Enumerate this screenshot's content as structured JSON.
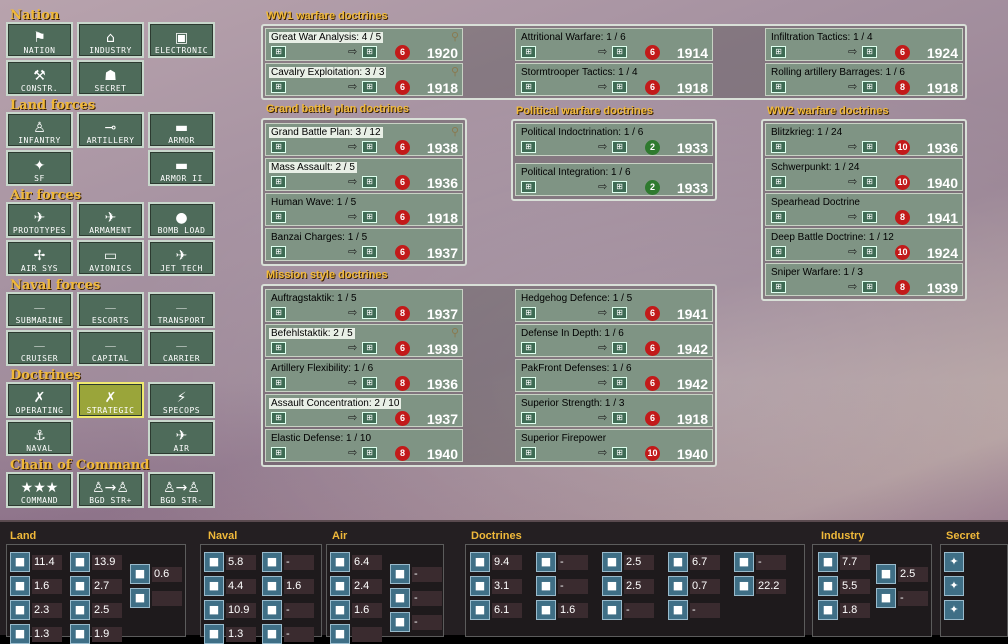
{
  "categories": [
    {
      "title": "Nation",
      "buttons": [
        {
          "label": "NATION",
          "icon": "flag-icon",
          "glyph": "⚑"
        },
        {
          "label": "INDUSTRY",
          "icon": "factory-icon",
          "glyph": "⌂"
        },
        {
          "label": "ELECTRONIC",
          "icon": "chip-icon",
          "glyph": "▣"
        },
        {
          "label": "CONSTR.",
          "icon": "construction-icon",
          "glyph": "⚒"
        },
        {
          "label": "SECRET",
          "icon": "agent-icon",
          "glyph": "☗"
        }
      ]
    },
    {
      "title": "Land forces",
      "buttons": [
        {
          "label": "INFANTRY",
          "icon": "infantry-icon",
          "glyph": "♙"
        },
        {
          "label": "ARTILLERY",
          "icon": "artillery-icon",
          "glyph": "⊸"
        },
        {
          "label": "ARMOR",
          "icon": "tank-icon",
          "glyph": "▬"
        },
        {
          "label": "SF",
          "icon": "special-forces-icon",
          "glyph": "✦"
        },
        {
          "label": "ARMOR II",
          "icon": "tank-icon",
          "glyph": "▬"
        }
      ]
    },
    {
      "title": "Air forces",
      "buttons": [
        {
          "label": "PROTOTYPES",
          "icon": "plane-icon",
          "glyph": "✈"
        },
        {
          "label": "ARMAMENT",
          "icon": "plane-icon",
          "glyph": "✈"
        },
        {
          "label": "BOMB LOAD",
          "icon": "bomb-icon",
          "glyph": "●"
        },
        {
          "label": "AIR SYS",
          "icon": "propeller-icon",
          "glyph": "✢"
        },
        {
          "label": "AVIONICS",
          "icon": "radio-icon",
          "glyph": "▭"
        },
        {
          "label": "JET TECH",
          "icon": "jet-icon",
          "glyph": "✈"
        }
      ]
    },
    {
      "title": "Naval forces",
      "buttons": [
        {
          "label": "SUBMARINE",
          "icon": "submarine-icon",
          "glyph": "⏤"
        },
        {
          "label": "ESCORTS",
          "icon": "ship-icon",
          "glyph": "⏤"
        },
        {
          "label": "TRANSPORT",
          "icon": "ship-icon",
          "glyph": "⏤"
        },
        {
          "label": "CRUISER",
          "icon": "ship-icon",
          "glyph": "⏤"
        },
        {
          "label": "CAPITAL",
          "icon": "ship-icon",
          "glyph": "⏤"
        },
        {
          "label": "CARRIER",
          "icon": "carrier-icon",
          "glyph": "⏤"
        }
      ]
    },
    {
      "title": "Doctrines",
      "buttons": [
        {
          "label": "OPERATING",
          "icon": "doctrine-icon",
          "glyph": "✗"
        },
        {
          "label": "STRATEGIC",
          "icon": "doctrine-icon",
          "glyph": "✗"
        },
        {
          "label": "SPECOPS",
          "icon": "lightning-icon",
          "glyph": "⚡"
        },
        {
          "label": "NAVAL",
          "icon": "anchor-icon",
          "glyph": "⚓"
        },
        {
          "label": "AIR",
          "icon": "plane-icon",
          "glyph": "✈"
        }
      ]
    },
    {
      "title": "Chain of Command",
      "buttons": [
        {
          "label": "COMMAND",
          "icon": "stars-icon",
          "glyph": "★★★"
        },
        {
          "label": "BGD STR+",
          "icon": "brigade-plus-icon",
          "glyph": "♙→♙"
        },
        {
          "label": "BGD STR-",
          "icon": "brigade-minus-icon",
          "glyph": "♙→♙"
        }
      ]
    }
  ],
  "groups": {
    "ww1": "WW1 warfare doctrines",
    "grand": "Grand battle plan doctrines",
    "political": "Political warfare doctrines",
    "ww2": "WW2 warfare doctrines",
    "mission": "Mission style doctrines"
  },
  "cards": [
    {
      "name": "Great War Analysis: 4 / 5",
      "cost": "6",
      "year": "1920",
      "lit": true,
      "mag": true
    },
    {
      "name": "Cavalry Exploitation: 3 / 3",
      "cost": "6",
      "year": "1918",
      "lit": true,
      "mag": true
    },
    {
      "name": "Attritional Warfare: 1 / 6",
      "cost": "6",
      "year": "1914"
    },
    {
      "name": "Stormtrooper Tactics: 1 / 4",
      "cost": "6",
      "year": "1918"
    },
    {
      "name": "Infiltration Tactics: 1 / 4",
      "cost": "6",
      "year": "1924"
    },
    {
      "name": "Rolling artillery Barrages: 1 / 6",
      "cost": "8",
      "year": "1918"
    },
    {
      "name": "Grand Battle Plan: 3 / 12",
      "cost": "6",
      "year": "1938",
      "lit": true,
      "mag": true
    },
    {
      "name": "Mass Assault: 2 / 5",
      "cost": "6",
      "year": "1936",
      "lit": true
    },
    {
      "name": "Human Wave: 1 / 5",
      "cost": "6",
      "year": "1918"
    },
    {
      "name": "Banzai Charges: 1 / 5",
      "cost": "6",
      "year": "1937"
    },
    {
      "name": "Political Indoctrination: 1 / 6",
      "cost": "2",
      "year": "1933",
      "green": true
    },
    {
      "name": "Political Integration: 1 / 6",
      "cost": "2",
      "year": "1933",
      "green": true
    },
    {
      "name": "Blitzkrieg: 1 / 24",
      "cost": "10",
      "year": "1936"
    },
    {
      "name": "Schwerpunkt: 1 / 24",
      "cost": "10",
      "year": "1940"
    },
    {
      "name": "Spearhead Doctrine",
      "cost": "8",
      "year": "1941"
    },
    {
      "name": "Deep Battle Doctrine: 1 / 12",
      "cost": "10",
      "year": "1924"
    },
    {
      "name": "Sniper Warfare: 1 / 3",
      "cost": "8",
      "year": "1939"
    },
    {
      "name": "Auftragstaktik: 1 / 5",
      "cost": "8",
      "year": "1937"
    },
    {
      "name": "Befehlstaktik: 2 / 5",
      "cost": "6",
      "year": "1939",
      "lit": true,
      "mag": true
    },
    {
      "name": "Artillery Flexibility: 1 / 6",
      "cost": "8",
      "year": "1936"
    },
    {
      "name": "Assault Concentration: 2 / 10",
      "cost": "6",
      "year": "1937",
      "lit": true
    },
    {
      "name": "Elastic Defense: 1 / 10",
      "cost": "8",
      "year": "1940"
    },
    {
      "name": "Hedgehog Defence: 1 / 5",
      "cost": "6",
      "year": "1941"
    },
    {
      "name": "Defense In Depth: 1 / 6",
      "cost": "6",
      "year": "1942"
    },
    {
      "name": "PakFront Defenses: 1 / 6",
      "cost": "6",
      "year": "1942"
    },
    {
      "name": "Superior Strength: 1 / 3",
      "cost": "6",
      "year": "1918"
    },
    {
      "name": "Superior Firepower",
      "cost": "10",
      "year": "1940"
    }
  ],
  "bottom": {
    "land": {
      "title": "Land",
      "values": [
        "11.4",
        "13.9",
        "1.6",
        "2.7",
        "2.3",
        "2.5",
        "1.3",
        "1.9"
      ],
      "side": [
        "0.6",
        ""
      ]
    },
    "naval": {
      "title": "Naval",
      "values": [
        "5.8",
        "-",
        "4.4",
        "1.6",
        "10.9",
        "-",
        "1.3",
        "-"
      ]
    },
    "air": {
      "title": "Air",
      "values": [
        "6.4",
        "2.4",
        "1.6",
        ""
      ],
      "side": [
        "-",
        "-",
        "-"
      ]
    },
    "doctrines": {
      "title": "Doctrines",
      "values": [
        "9.4",
        "-",
        "2.5",
        "6.7",
        "-",
        "3.1",
        "-",
        "2.5",
        "0.7",
        "22.2",
        "6.1",
        "1.6",
        "-",
        "-"
      ]
    },
    "industry": {
      "title": "Industry",
      "values": [
        "7.7",
        "5.5",
        "1.8"
      ],
      "side": [
        "2.5",
        "-"
      ]
    },
    "secret": {
      "title": "Secret"
    }
  }
}
